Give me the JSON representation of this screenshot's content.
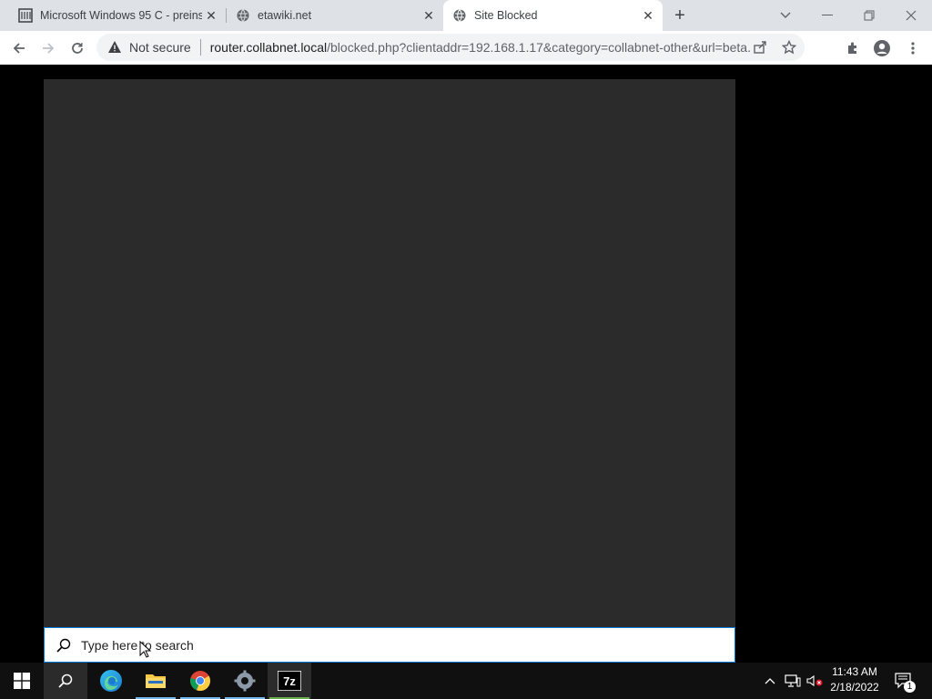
{
  "browser": {
    "tabs": [
      {
        "title": "Microsoft Windows 95 C - preins",
        "icon": "archive-icon",
        "active": false
      },
      {
        "title": "etawiki.net",
        "icon": "globe-icon",
        "active": false
      },
      {
        "title": "Site Blocked",
        "icon": "globe-icon",
        "active": true
      }
    ],
    "omnibox": {
      "security_label": "Not secure",
      "url_host": "router.collabnet.local",
      "url_rest": "/blocked.php?clientaddr=192.168.1.17&category=collabnet-other&url=beta..."
    }
  },
  "taskbar": {
    "search_placeholder": "Type here to search",
    "clock_time": "11:43 AM",
    "clock_date": "2/18/2022",
    "notification_count": "1",
    "apps": [
      "start-icon",
      "search-icon",
      "edge-icon",
      "file-explorer-icon",
      "chrome-icon",
      "settings-icon",
      "7zip-icon"
    ]
  },
  "colors": {
    "accent": "#0078d7",
    "panel": "#2b2b2b",
    "taskbar": "#101010"
  }
}
